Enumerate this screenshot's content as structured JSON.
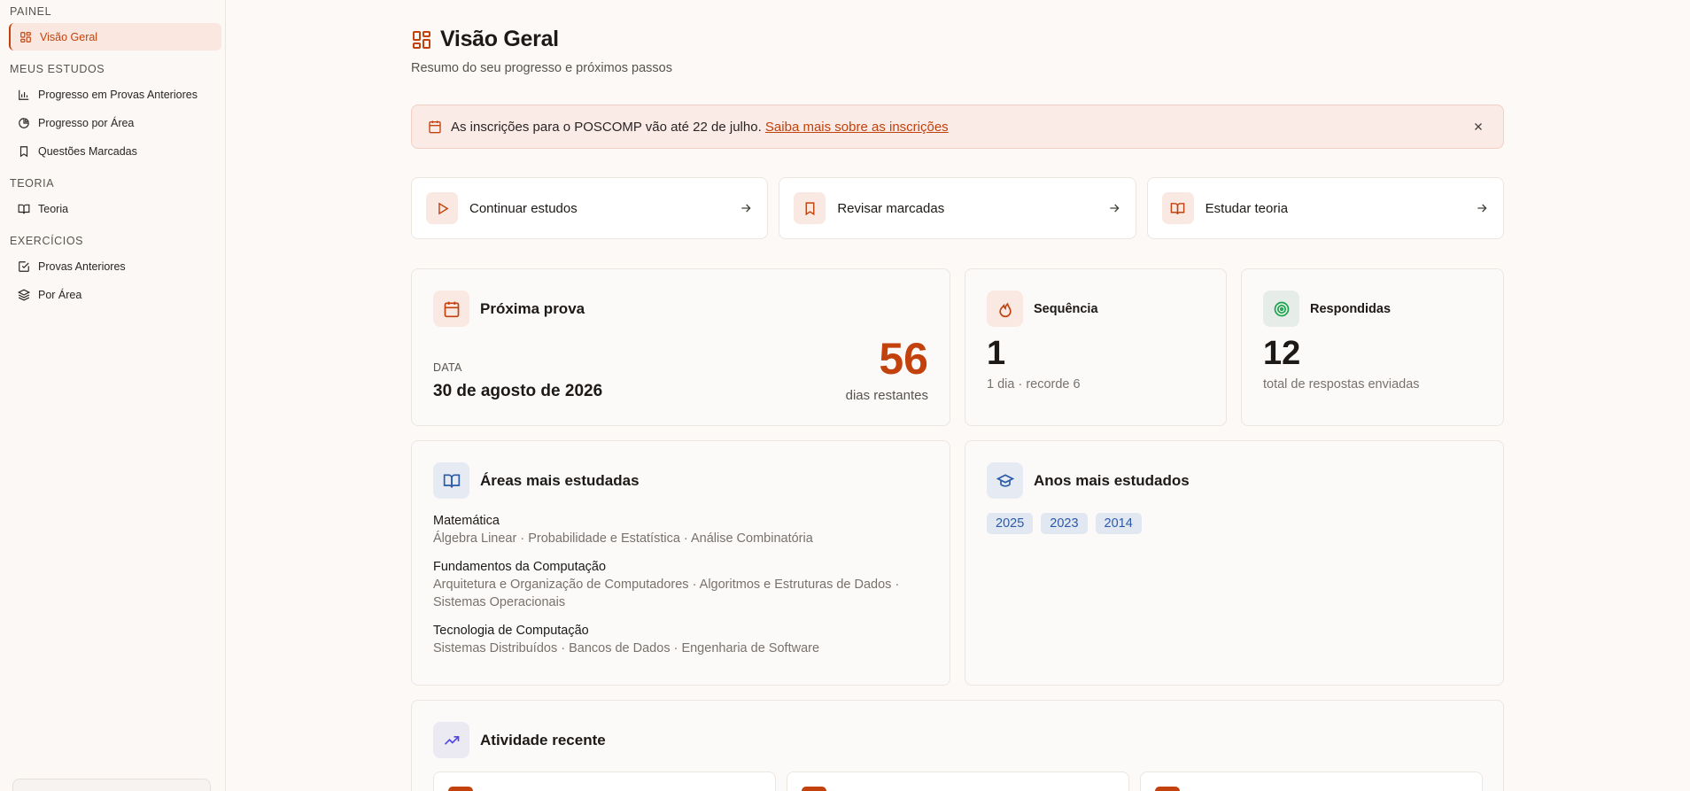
{
  "sidebar": {
    "sections": [
      {
        "label": "PAINEL",
        "items": [
          {
            "label": "Visão Geral"
          }
        ]
      },
      {
        "label": "MEUS ESTUDOS",
        "items": [
          {
            "label": "Progresso em Provas Anteriores"
          },
          {
            "label": "Progresso por Área"
          },
          {
            "label": "Questões Marcadas"
          }
        ]
      },
      {
        "label": "TEORIA",
        "items": [
          {
            "label": "Teoria"
          }
        ]
      },
      {
        "label": "EXERCÍCIOS",
        "items": [
          {
            "label": "Provas Anteriores"
          },
          {
            "label": "Por Área"
          }
        ]
      }
    ]
  },
  "page": {
    "title": "Visão Geral",
    "subtitle": "Resumo do seu progresso e próximos passos"
  },
  "banner": {
    "text": "As inscrições para o POSCOMP vão até 22 de julho.",
    "link": "Saiba mais sobre as inscrições"
  },
  "quick_actions": [
    {
      "label": "Continuar estudos"
    },
    {
      "label": "Revisar marcadas"
    },
    {
      "label": "Estudar teoria"
    }
  ],
  "next_exam": {
    "title": "Próxima prova",
    "date_label": "DATA",
    "date": "30 de agosto de 2026",
    "days": "56",
    "days_label": "dias restantes"
  },
  "streak": {
    "title": "Sequência",
    "value": "1",
    "sub": "1 dia · recorde 6"
  },
  "answered": {
    "title": "Respondidas",
    "value": "12",
    "sub": "total de respostas enviadas"
  },
  "areas": {
    "title": "Áreas mais estudadas",
    "items": [
      {
        "name": "Matemática",
        "topics": "Álgebra Linear · Probabilidade e Estatística · Análise Combinatória"
      },
      {
        "name": "Fundamentos da Computação",
        "topics": "Arquitetura e Organização de Computadores · Algoritmos e Estruturas de Dados · Sistemas Operacionais"
      },
      {
        "name": "Tecnologia de Computação",
        "topics": "Sistemas Distribuídos · Bancos de Dados · Engenharia de Software"
      }
    ]
  },
  "years": {
    "title": "Anos mais estudados",
    "items": [
      "2025",
      "2023",
      "2014"
    ]
  },
  "activity": {
    "title": "Atividade recente"
  },
  "colors": {
    "accent": "#c2410c",
    "accent_bg": "#f9e9e2",
    "year_chip_bg": "#e2e8f2",
    "year_chip_text": "#2b5aa8",
    "respondidas_icon": "#16a34a"
  }
}
